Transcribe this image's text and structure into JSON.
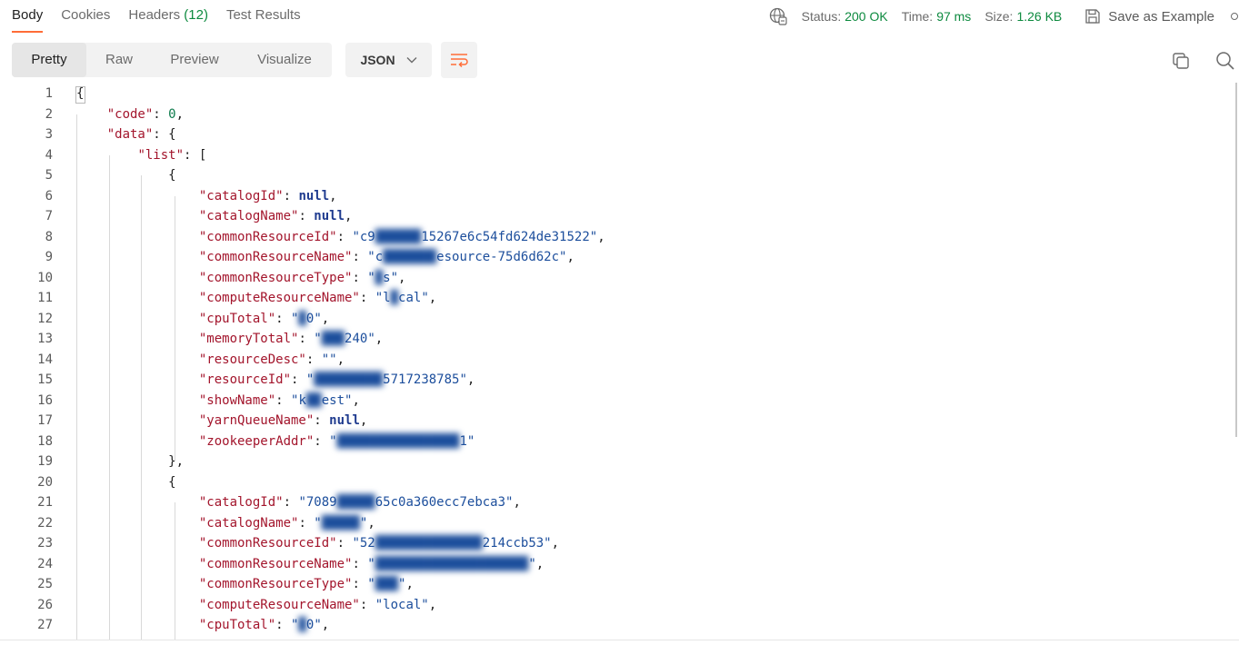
{
  "response_tabs": [
    "Body",
    "Cookies",
    "Headers",
    "Test Results"
  ],
  "headers_count": "(12)",
  "status": {
    "status_label": "Status:",
    "status_value": "200 OK",
    "time_label": "Time:",
    "time_value": "97 ms",
    "size_label": "Size:",
    "size_value": "1.26 KB"
  },
  "save_example_label": "Save as Example",
  "view_modes": [
    "Pretty",
    "Raw",
    "Preview",
    "Visualize"
  ],
  "selected_view": "Pretty",
  "format": "JSON",
  "icons": {
    "network": "globe-network-icon",
    "save": "floppy-save-icon",
    "more": "more-options-icon",
    "dropdown": "chevron-down-icon",
    "wrap": "word-wrap-icon",
    "copy": "copy-icon",
    "search": "search-icon"
  },
  "colors": {
    "accent": "#ff6c37",
    "status_ok": "#0d8a3f",
    "json_key": "#a3152c",
    "json_string": "#1c4e9c",
    "json_number": "#0c7a4b",
    "json_null": "#1f3b8f"
  },
  "code_lines": [
    {
      "n": "1",
      "t": "{"
    },
    {
      "n": "2",
      "t": "    \"code\": 0,"
    },
    {
      "n": "3",
      "t": "    \"data\": {"
    },
    {
      "n": "4",
      "t": "        \"list\": ["
    },
    {
      "n": "5",
      "t": "            {"
    },
    {
      "n": "6",
      "t": "                \"catalogId\": null,"
    },
    {
      "n": "7",
      "t": "                \"catalogName\": null,"
    },
    {
      "n": "8",
      "t": "                \"commonResourceId\": \"c9██████15267e6c54fd624de31522\","
    },
    {
      "n": "9",
      "t": "                \"commonResourceName\": \"c███████esource-75d6d62c\","
    },
    {
      "n": "10",
      "t": "                \"commonResourceType\": \"█s\","
    },
    {
      "n": "11",
      "t": "                \"computeResourceName\": \"l█cal\","
    },
    {
      "n": "12",
      "t": "                \"cpuTotal\": \"█0\","
    },
    {
      "n": "13",
      "t": "                \"memoryTotal\": \"███240\","
    },
    {
      "n": "14",
      "t": "                \"resourceDesc\": \"\","
    },
    {
      "n": "15",
      "t": "                \"resourceId\": \"█████████5717238785\","
    },
    {
      "n": "16",
      "t": "                \"showName\": \"k██est\","
    },
    {
      "n": "17",
      "t": "                \"yarnQueueName\": null,"
    },
    {
      "n": "18",
      "t": "                \"zookeeperAddr\": \"████████████████1\""
    },
    {
      "n": "19",
      "t": "            },"
    },
    {
      "n": "20",
      "t": "            {"
    },
    {
      "n": "21",
      "t": "                \"catalogId\": \"7089█████65c0a360ecc7ebca3\","
    },
    {
      "n": "22",
      "t": "                \"catalogName\": \"█████\","
    },
    {
      "n": "23",
      "t": "                \"commonResourceId\": \"52██████████████214ccb53\","
    },
    {
      "n": "24",
      "t": "                \"commonResourceName\": \"████████████████████\","
    },
    {
      "n": "25",
      "t": "                \"commonResourceType\": \"███\","
    },
    {
      "n": "26",
      "t": "                \"computeResourceName\": \"local\","
    },
    {
      "n": "27",
      "t": "                \"cpuTotal\": \"█0\","
    }
  ]
}
